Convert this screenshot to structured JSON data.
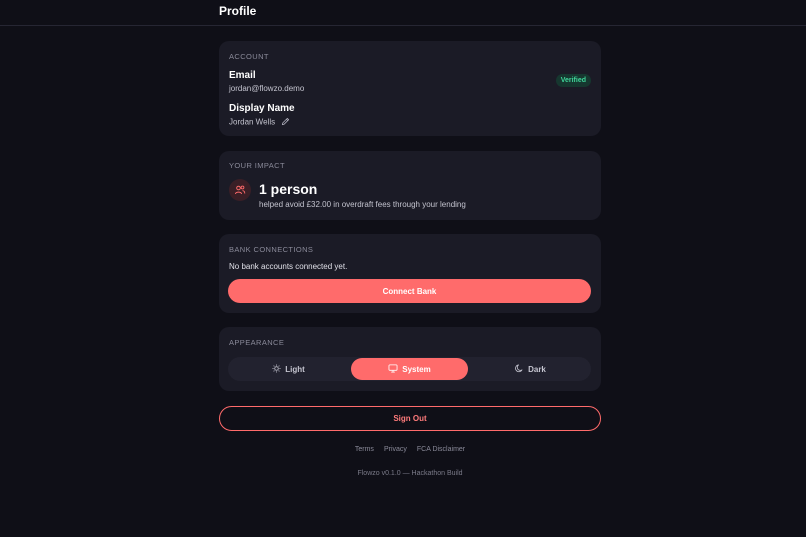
{
  "header": {
    "title": "Profile"
  },
  "account": {
    "section_label": "ACCOUNT",
    "email_label": "Email",
    "email_value": "jordan@flowzo.demo",
    "verified_badge": "Verified",
    "display_name_label": "Display Name",
    "display_name_value": "Jordan Wells"
  },
  "impact": {
    "section_label": "YOUR IMPACT",
    "headline": "1 person",
    "subtext": "helped avoid £32.00 in overdraft fees through your lending",
    "icon": "users-icon"
  },
  "bank": {
    "section_label": "BANK CONNECTIONS",
    "empty_text": "No bank accounts connected yet.",
    "connect_label": "Connect Bank"
  },
  "appearance": {
    "section_label": "APPEARANCE",
    "options": [
      {
        "label": "Light",
        "icon": "sun-icon",
        "selected": false
      },
      {
        "label": "System",
        "icon": "monitor-icon",
        "selected": true
      },
      {
        "label": "Dark",
        "icon": "moon-icon",
        "selected": false
      }
    ]
  },
  "actions": {
    "sign_out_label": "Sign Out"
  },
  "footer": {
    "links": [
      "Terms",
      "Privacy",
      "FCA Disclaimer"
    ],
    "version": "Flowzo v0.1.0 — Hackathon Build"
  },
  "colors": {
    "background": "#0f0f17",
    "card": "#1b1b26",
    "accent": "#ff6b6b",
    "verified": "#3fd69a"
  }
}
